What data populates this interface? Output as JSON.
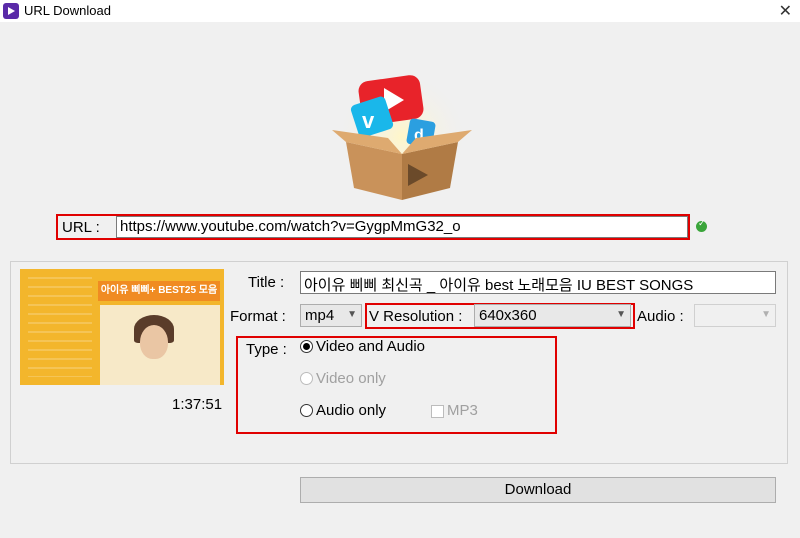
{
  "window": {
    "title": "URL Download",
    "close_glyph": "✕"
  },
  "url": {
    "label": "URL :",
    "value": "https://www.youtube.com/watch?v=GygpMmG32_o"
  },
  "video": {
    "thumbnail_banner": "아이유 삐삐+ BEST25 모음",
    "duration": "1:37:51",
    "title_label": "Title :",
    "title_value": "아이유 삐삐 최신곡 _ 아이유 best 노래모음 IU BEST SONGS"
  },
  "format": {
    "label": "Format :",
    "value": "mp4"
  },
  "v_resolution": {
    "label": "V Resolution :",
    "value": "640x360"
  },
  "audio": {
    "label": "Audio :",
    "value": ""
  },
  "type": {
    "label": "Type :",
    "options": [
      {
        "label": "Video and Audio",
        "selected": true,
        "enabled": true
      },
      {
        "label": "Video only",
        "selected": false,
        "enabled": false
      },
      {
        "label": "Audio only",
        "selected": false,
        "enabled": true
      }
    ],
    "mp3_label": "MP3"
  },
  "download_label": "Download",
  "colors": {
    "highlight": "#e00000",
    "status_ok": "#3aa53a"
  },
  "icons": [
    "app-icon",
    "close-icon",
    "status-ok-icon",
    "chevron-down-icon",
    "video-download-logo"
  ]
}
